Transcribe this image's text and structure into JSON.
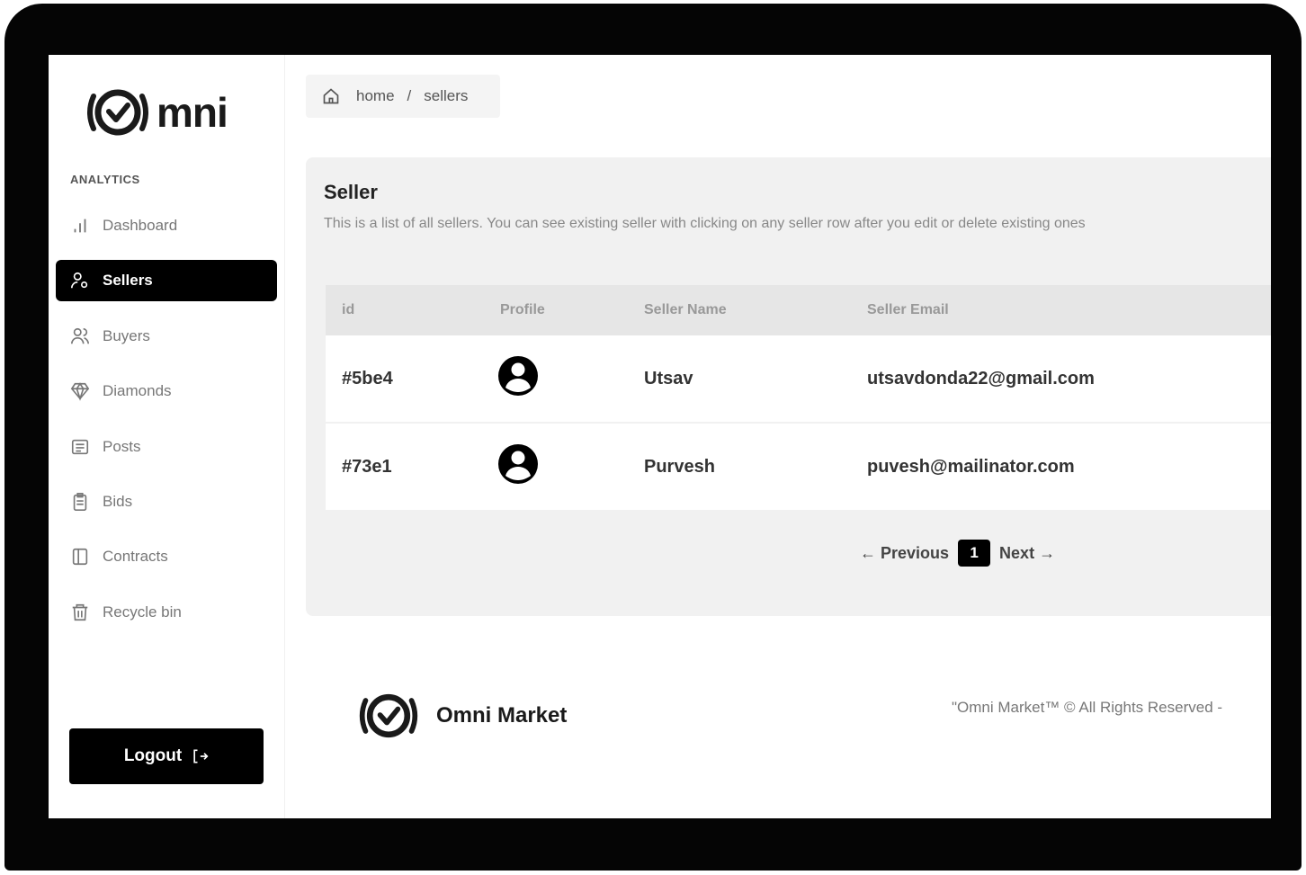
{
  "brand": {
    "logo_text": "mni",
    "footer_name": "Omni Market",
    "copyright": "\"Omni Market™ © All Rights Reserved -"
  },
  "sidebar": {
    "section_label": "ANALYTICS",
    "items": [
      {
        "label": "Dashboard",
        "icon": "bar-chart-icon",
        "active": false
      },
      {
        "label": "Sellers",
        "icon": "user-settings-icon",
        "active": true
      },
      {
        "label": "Buyers",
        "icon": "users-icon",
        "active": false
      },
      {
        "label": "Diamonds",
        "icon": "diamond-icon",
        "active": false
      },
      {
        "label": "Posts",
        "icon": "posts-icon",
        "active": false
      },
      {
        "label": "Bids",
        "icon": "clipboard-icon",
        "active": false
      },
      {
        "label": "Contracts",
        "icon": "contract-icon",
        "active": false
      },
      {
        "label": "Recycle bin",
        "icon": "trash-icon",
        "active": false
      }
    ],
    "logout_label": "Logout"
  },
  "breadcrumb": {
    "home": "home",
    "separator": "/",
    "current": "sellers"
  },
  "panel": {
    "title": "Seller",
    "description": "This is a list of all sellers. You can see existing seller with clicking on any seller row after you edit or delete existing ones",
    "columns": [
      "id",
      "Profile",
      "Seller Name",
      "Seller Email"
    ],
    "rows": [
      {
        "id": "#5be4",
        "name": "Utsav",
        "email": "utsavdonda22@gmail.com"
      },
      {
        "id": "#73e1",
        "name": "Purvesh",
        "email": "puvesh@mailinator.com"
      }
    ]
  },
  "pagination": {
    "previous": "← Previous",
    "page": "1",
    "next": "Next →"
  }
}
